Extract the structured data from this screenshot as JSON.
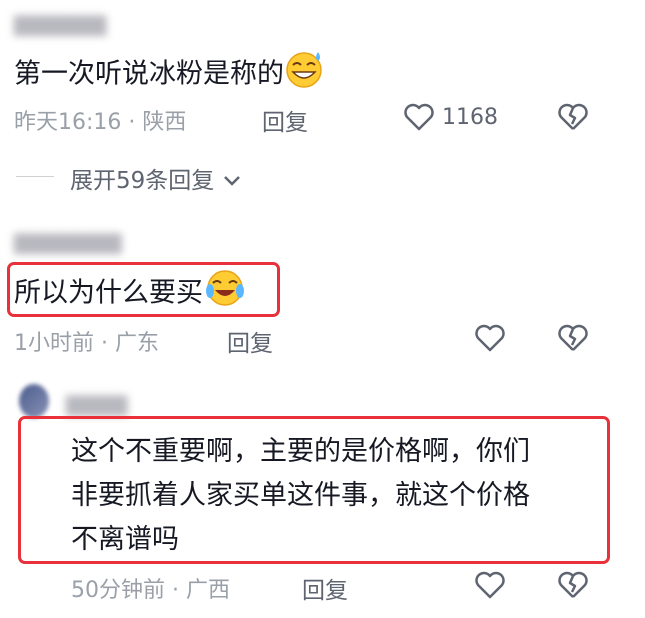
{
  "comments": [
    {
      "author": "▇▇▇▇▇▇",
      "text": "第一次听说冰粉是称的",
      "emoji": "grinning-sweat-emoji",
      "time": "昨天16:16",
      "separator": "·",
      "location": "陕西",
      "reply_label": "回复",
      "like_count": "1168",
      "expand_label": "展开59条回复"
    },
    {
      "author": "▇▇▇▇▇▇▇",
      "text": "所以为什么要买",
      "emoji": "crying-laughing-emoji",
      "time": "1小时前",
      "separator": "·",
      "location": "广东",
      "reply_label": "回复"
    },
    {
      "author": "▇▇▇▇",
      "text_lines": [
        "这个不重要啊，主要的是价格啊，你们",
        "非要抓着人家买单这件事，就这个价格",
        "不离谱吗"
      ],
      "time": "50分钟前",
      "separator": "·",
      "location": "广西",
      "reply_label": "回复"
    }
  ],
  "colors": {
    "highlight_border": "#e8313b",
    "meta_text": "#9aa0a8",
    "primary_text": "#161823"
  },
  "icons": [
    "heart-outline-icon",
    "broken-heart-icon",
    "chevron-down-icon"
  ]
}
